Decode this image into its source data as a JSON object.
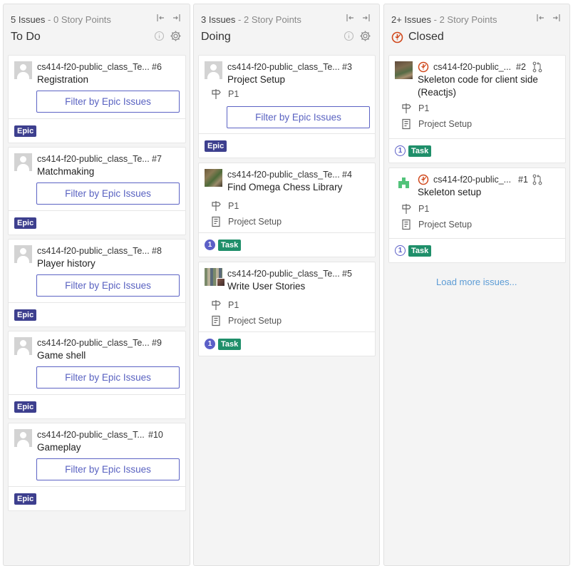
{
  "columns": [
    {
      "meta_count": "5 Issues",
      "meta_sep": " - ",
      "meta_points": "0 Story Points",
      "title": "To Do",
      "cards": [
        {
          "repo": "cs414-f20-public_class_Te...",
          "number": "#6",
          "title": "Registration",
          "filter_label": "Filter by Epic Issues",
          "badge": "Epic"
        },
        {
          "repo": "cs414-f20-public_class_Te...",
          "number": "#7",
          "title": "Matchmaking",
          "filter_label": "Filter by Epic Issues",
          "badge": "Epic"
        },
        {
          "repo": "cs414-f20-public_class_Te...",
          "number": "#8",
          "title": "Player history",
          "filter_label": "Filter by Epic Issues",
          "badge": "Epic"
        },
        {
          "repo": "cs414-f20-public_class_Te...",
          "number": "#9",
          "title": "Game shell",
          "filter_label": "Filter by Epic Issues",
          "badge": "Epic"
        },
        {
          "repo": "cs414-f20-public_class_T...",
          "number": "#10",
          "title": "Gameplay",
          "filter_label": "Filter by Epic Issues",
          "badge": "Epic"
        }
      ]
    },
    {
      "meta_count": "3 Issues",
      "meta_sep": " - ",
      "meta_points": "2 Story Points",
      "title": "Doing",
      "cards": [
        {
          "repo": "cs414-f20-public_class_Te...",
          "number": "#3",
          "title": "Project Setup",
          "priority": "P1",
          "filter_label": "Filter by Epic Issues",
          "badge": "Epic"
        },
        {
          "repo": "cs414-f20-public_class_Te...",
          "number": "#4",
          "title": "Find Omega Chess Library",
          "priority": "P1",
          "epic": "Project Setup",
          "estimate": "1",
          "badge": "Task"
        },
        {
          "repo": "cs414-f20-public_class_Te...",
          "number": "#5",
          "title": "Write User Stories",
          "priority": "P1",
          "epic": "Project Setup",
          "estimate": "1",
          "badge": "Task"
        }
      ]
    },
    {
      "meta_count": "2+ Issues",
      "meta_sep": " - ",
      "meta_points": "2 Story Points",
      "title": "Closed",
      "cards": [
        {
          "repo": "cs414-f20-public_...",
          "number": "#2",
          "title_line1": "Skeleton code for client side",
          "title_line2": "(Reactjs)",
          "priority": "P1",
          "epic": "Project Setup",
          "estimate": "1",
          "badge": "Task"
        },
        {
          "repo": "cs414-f20-public_...",
          "number": "#1",
          "title": "Skeleton setup",
          "priority": "P1",
          "epic": "Project Setup",
          "estimate": "1",
          "badge": "Task"
        }
      ],
      "load_more": "Load more issues..."
    }
  ],
  "colors": {
    "epic": "#3d3f8e",
    "task": "#1f8f6a",
    "filter": "#5962c1",
    "closed": "#d0481c",
    "link": "#5b9bd5"
  }
}
